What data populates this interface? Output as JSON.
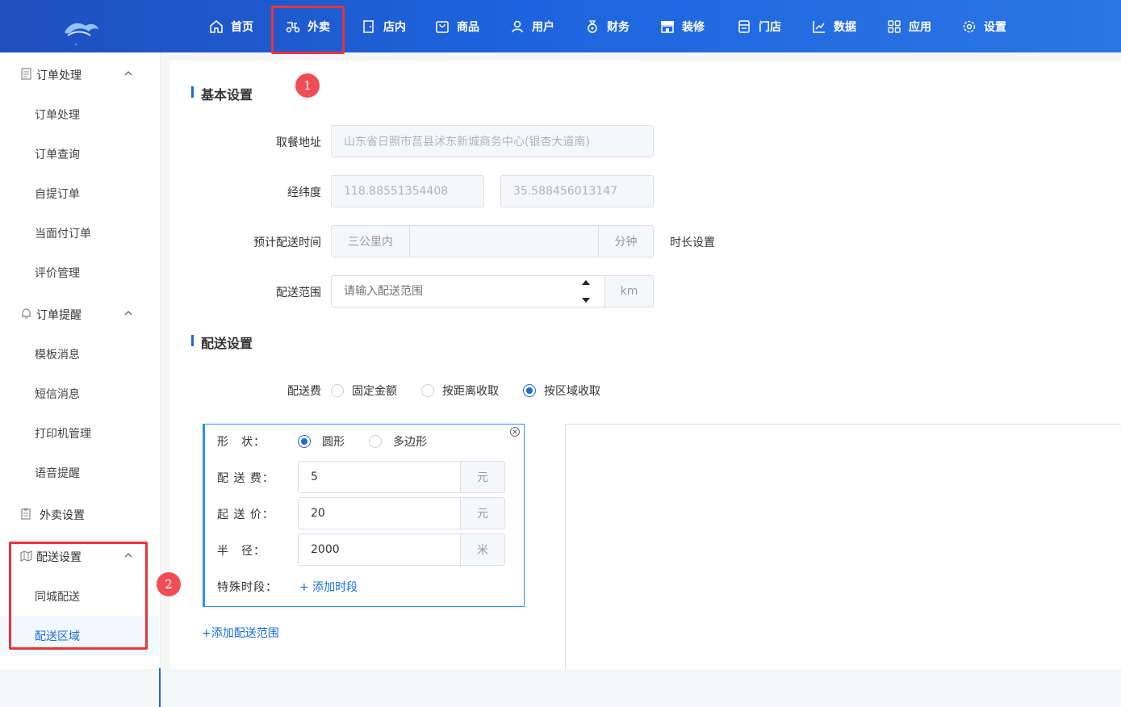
{
  "nav": {
    "items": [
      {
        "label": "首页",
        "icon": "home-icon"
      },
      {
        "label": "外卖",
        "icon": "scooter-icon"
      },
      {
        "label": "店内",
        "icon": "door-icon"
      },
      {
        "label": "商品",
        "icon": "bag-icon"
      },
      {
        "label": "用户",
        "icon": "user-icon"
      },
      {
        "label": "财务",
        "icon": "money-bag-icon"
      },
      {
        "label": "装修",
        "icon": "storefront-icon"
      },
      {
        "label": "门店",
        "icon": "shop-icon"
      },
      {
        "label": "数据",
        "icon": "line-chart-icon"
      },
      {
        "label": "应用",
        "icon": "apps-grid-icon"
      },
      {
        "label": "设置",
        "icon": "gear-icon"
      }
    ],
    "active": "外卖"
  },
  "sidebar": {
    "groups": [
      {
        "label": "订单处理",
        "icon": "document-icon",
        "items": [
          "订单处理",
          "订单查询",
          "自提订单",
          "当面付订单",
          "评价管理"
        ]
      },
      {
        "label": "订单提醒",
        "icon": "bell-icon",
        "items": [
          "模板消息",
          "短信消息",
          "打印机管理",
          "语音提醒"
        ]
      },
      {
        "label": "外卖设置",
        "icon": "clipboard-icon",
        "items": []
      },
      {
        "label": "配送设置",
        "icon": "map-icon",
        "items": [
          "同城配送",
          "配送区域"
        ]
      }
    ],
    "active_item": "配送区域"
  },
  "basic": {
    "title": "基本设置",
    "pickup_label": "取餐地址",
    "pickup_value": "山东省日照市莒县沭东新城商务中心(银杏大道南)",
    "latlng_label": "经纬度",
    "lng_value": "118.88551354408",
    "lat_value": "35.588456013147",
    "eta_label": "预计配送时间",
    "eta_prefix": "三公里内",
    "eta_value": "",
    "eta_unit": "分钟",
    "eta_link": "时长设置",
    "range_label": "配送范围",
    "range_placeholder": "请输入配送范围",
    "range_unit": "km"
  },
  "delivery": {
    "title": "配送设置",
    "fee_label": "配送费",
    "fee_options": [
      "固定金额",
      "按距离收取",
      "按区域收取"
    ],
    "fee_selected": "按区域收取"
  },
  "zone": {
    "shape_label": "形　状：",
    "shape_options": [
      "圆形",
      "多边形"
    ],
    "shape_selected": "圆形",
    "fee_label": "配 送 费：",
    "fee_value": "5",
    "fee_unit": "元",
    "min_label": "起 送 价：",
    "min_value": "20",
    "min_unit": "元",
    "radius_label": "半　径：",
    "radius_value": "2000",
    "radius_unit": "米",
    "special_label": "特殊时段：",
    "add_time_link": "+ 添加时段"
  },
  "add_range_link": "+添加配送范围",
  "annotations": [
    "1",
    "2"
  ],
  "colors": {
    "primary": "#1a6bd8",
    "highlight": "#e8353b",
    "badge": "#ef4d55"
  }
}
